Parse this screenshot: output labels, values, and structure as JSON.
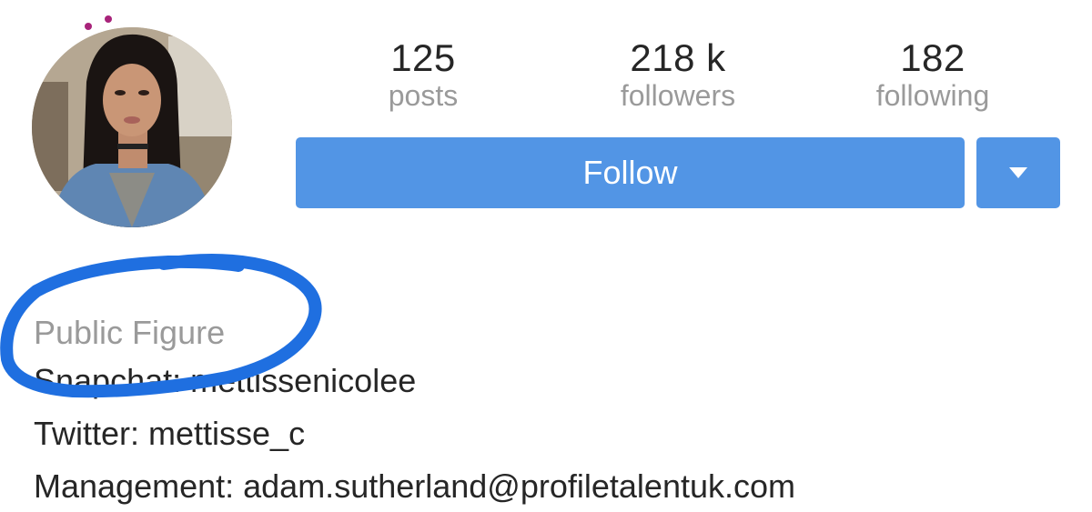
{
  "profile": {
    "avatar_icon": "profile-photo",
    "story_ring_color": "#a8237a"
  },
  "stats": {
    "posts": {
      "value": "125",
      "label": "posts"
    },
    "followers": {
      "value": "218 k",
      "label": "followers"
    },
    "following": {
      "value": "182",
      "label": "following"
    }
  },
  "actions": {
    "follow_label": "Follow",
    "dropdown_icon": "caret-down-icon",
    "button_color": "#5295e5"
  },
  "bio": {
    "category": "Public Figure",
    "lines": [
      "Snapchat: mettissenicolee",
      "Twitter: mettisse_c",
      "Management: adam.sutherland@profiletalentuk.com"
    ]
  },
  "annotation": {
    "type": "hand-drawn circle",
    "color": "#1f6fe0"
  }
}
